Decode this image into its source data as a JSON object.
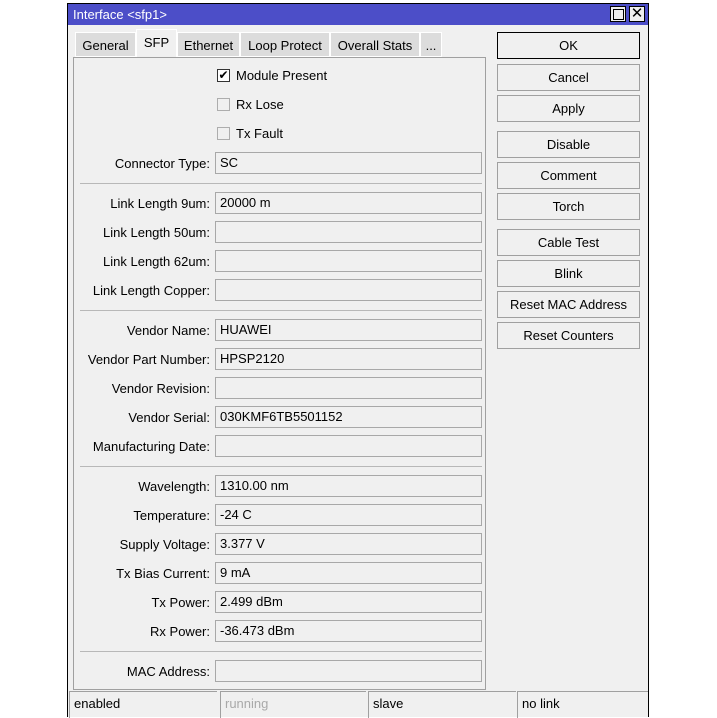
{
  "window": {
    "title": "Interface <sfp1>",
    "maximize_icon": "maximize-icon",
    "close_icon": "close-icon",
    "close_glyph": "✕"
  },
  "tabs": [
    {
      "label": "General",
      "active": false
    },
    {
      "label": "SFP",
      "active": true
    },
    {
      "label": "Ethernet",
      "active": false
    },
    {
      "label": "Loop Protect",
      "active": false
    },
    {
      "label": "Overall Stats",
      "active": false
    },
    {
      "label": "...",
      "active": false
    }
  ],
  "checkboxes": [
    {
      "label": "Module Present",
      "checked": true,
      "glyph": "✔"
    },
    {
      "label": "Rx Lose",
      "checked": false,
      "glyph": ""
    },
    {
      "label": "Tx Fault",
      "checked": false,
      "glyph": ""
    }
  ],
  "fields": {
    "connector_type": {
      "label": "Connector Type:",
      "value": "SC"
    },
    "link_length_9um": {
      "label": "Link Length 9um:",
      "value": "20000 m"
    },
    "link_length_50um": {
      "label": "Link Length 50um:",
      "value": ""
    },
    "link_length_62um": {
      "label": "Link Length 62um:",
      "value": ""
    },
    "link_length_copper": {
      "label": "Link Length Copper:",
      "value": ""
    },
    "vendor_name": {
      "label": "Vendor Name:",
      "value": "HUAWEI"
    },
    "vendor_part_number": {
      "label": "Vendor Part Number:",
      "value": "HPSP2120"
    },
    "vendor_revision": {
      "label": "Vendor Revision:",
      "value": ""
    },
    "vendor_serial": {
      "label": "Vendor Serial:",
      "value": "030KMF6TB5501152"
    },
    "manufacturing_date": {
      "label": "Manufacturing Date:",
      "value": ""
    },
    "wavelength": {
      "label": "Wavelength:",
      "value": "1310.00 nm"
    },
    "temperature": {
      "label": "Temperature:",
      "value": "-24 C"
    },
    "supply_voltage": {
      "label": "Supply Voltage:",
      "value": "3.377 V"
    },
    "tx_bias_current": {
      "label": "Tx Bias Current:",
      "value": "9 mA"
    },
    "tx_power": {
      "label": "Tx Power:",
      "value": "2.499 dBm"
    },
    "rx_power": {
      "label": "Rx Power:",
      "value": "-36.473 dBm"
    },
    "mac_address": {
      "label": "MAC Address:",
      "value": ""
    }
  },
  "buttons": {
    "ok": "OK",
    "cancel": "Cancel",
    "apply": "Apply",
    "disable": "Disable",
    "comment": "Comment",
    "torch": "Torch",
    "cable_test": "Cable Test",
    "blink": "Blink",
    "reset_mac_address": "Reset MAC Address",
    "reset_counters": "Reset Counters"
  },
  "status_bar": {
    "state": "enabled",
    "running": "running",
    "role": "slave",
    "link": "no link"
  }
}
